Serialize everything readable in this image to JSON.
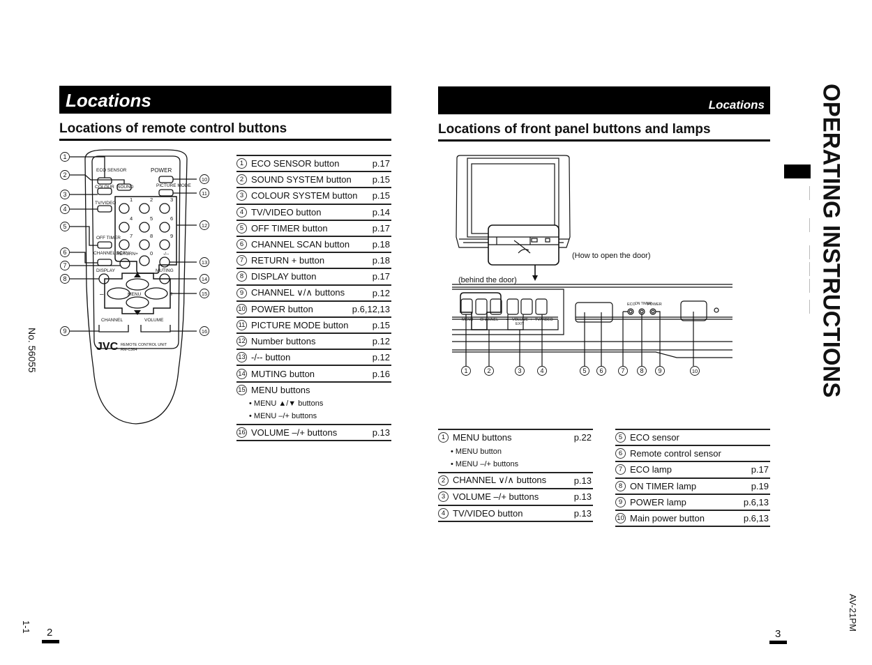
{
  "left_page": {
    "header": "Locations",
    "section_title": "Locations of remote control buttons",
    "remote_diagram": {
      "labels": {
        "eco_sensor": "ECO SENSOR",
        "colour": "COLOUR",
        "sound": "SOUND",
        "system": "SYSTEM",
        "power": "POWER",
        "picture_mode": "PICTURE MODE",
        "tv_video": "TV/VIDEO",
        "off_timer": "OFF TIMER",
        "channel_scan": "CHANNEL SCAN",
        "return_plus": "RETURN+",
        "dash": "-/--",
        "display": "DISPLAY",
        "muting": "MUTING",
        "menu": "MENU",
        "channel": "CHANNEL",
        "volume": "VOLUME",
        "brand": "JVC",
        "unit": "REMOTE CONTROL UNIT",
        "model": "RM-C364",
        "digits": [
          "1",
          "2",
          "3",
          "4",
          "5",
          "6",
          "7",
          "8",
          "9",
          "0"
        ]
      },
      "callouts": [
        "1",
        "2",
        "3",
        "4",
        "5",
        "6",
        "7",
        "8",
        "9",
        "10",
        "11",
        "12",
        "13",
        "14",
        "15",
        "16"
      ]
    },
    "table": [
      {
        "n": "1",
        "label": "ECO SENSOR button",
        "page": "p.17"
      },
      {
        "n": "2",
        "label": "SOUND SYSTEM button",
        "page": "p.15"
      },
      {
        "n": "3",
        "label": "COLOUR SYSTEM button",
        "page": "p.15"
      },
      {
        "n": "4",
        "label": "TV/VIDEO button",
        "page": "p.14"
      },
      {
        "n": "5",
        "label": "OFF TIMER button",
        "page": "p.17"
      },
      {
        "n": "6",
        "label": "CHANNEL SCAN button",
        "page": "p.18"
      },
      {
        "n": "7",
        "label": "RETURN + button",
        "page": "p.18"
      },
      {
        "n": "8",
        "label": "DISPLAY button",
        "page": "p.17"
      },
      {
        "n": "9",
        "label": "CHANNEL ∨/∧ buttons",
        "page": "p.12"
      },
      {
        "n": "10",
        "label": "POWER button",
        "page": "p.6,12,13"
      },
      {
        "n": "11",
        "label": "PICTURE MODE button",
        "page": "p.15"
      },
      {
        "n": "12",
        "label": "Number buttons",
        "page": "p.12"
      },
      {
        "n": "13",
        "label": "-/-- button",
        "page": "p.12"
      },
      {
        "n": "14",
        "label": "MUTING button",
        "page": "p.16"
      },
      {
        "n": "15",
        "label": "MENU buttons",
        "page": "",
        "subs": [
          "• MENU ▲/▼ buttons",
          "• MENU –/+ buttons"
        ]
      },
      {
        "n": "16",
        "label": "VOLUME –/+ buttons",
        "page": "p.13"
      }
    ],
    "doc_number": "No. 56055",
    "sheet": "1-1",
    "page_number": "2"
  },
  "right_page": {
    "header": "Locations",
    "section_title": "Locations of front panel buttons and lamps",
    "captions": {
      "how_to_open": "(How to open the door)",
      "behind_door": "(behind the door)"
    },
    "panel_labels": {
      "menu": "MENU",
      "channel": "CHANNEL",
      "volume": "VOLUME",
      "exit": "EXIT",
      "tv_video": "TV/VIDEO",
      "eco": "ECO",
      "on_timer": "ON TIMER",
      "power": "POWER",
      "minus": "–",
      "plus": "+"
    },
    "callouts": [
      "1",
      "2",
      "3",
      "4",
      "5",
      "6",
      "7",
      "8",
      "9",
      "10"
    ],
    "table_a": [
      {
        "n": "1",
        "label": "MENU buttons",
        "page": "p.22",
        "subs": [
          "• MENU button",
          "• MENU –/+ buttons"
        ]
      },
      {
        "n": "2",
        "label": "CHANNEL ∨/∧ buttons",
        "page": "p.13"
      },
      {
        "n": "3",
        "label": "VOLUME –/+ buttons",
        "page": "p.13"
      },
      {
        "n": "4",
        "label": "TV/VIDEO button",
        "page": "p.13"
      }
    ],
    "table_b": [
      {
        "n": "5",
        "label": "ECO sensor",
        "page": ""
      },
      {
        "n": "6",
        "label": "Remote control sensor",
        "page": ""
      },
      {
        "n": "7",
        "label": "ECO lamp",
        "page": "p.17"
      },
      {
        "n": "8",
        "label": "ON TIMER lamp",
        "page": "p.19"
      },
      {
        "n": "9",
        "label": "POWER lamp",
        "page": "p.6,13"
      },
      {
        "n": "10",
        "label": "Main power button",
        "page": "p.6,13"
      }
    ],
    "side_title": "OPERATING INSTRUCTIONS",
    "model": "AV-21PM",
    "page_number": "3"
  }
}
